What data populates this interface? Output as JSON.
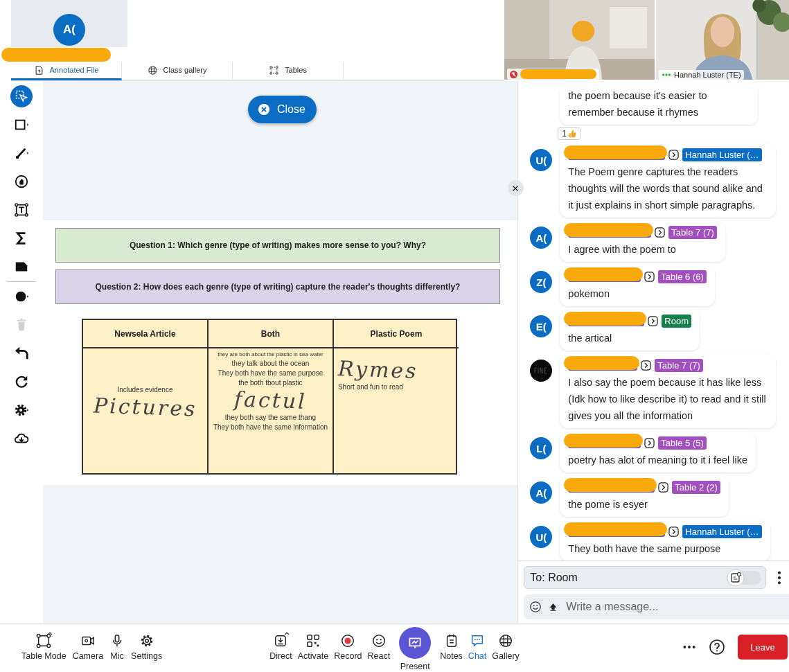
{
  "participant_tile": {
    "avatar": "A("
  },
  "tabs": [
    {
      "label": "Annotated File",
      "kind": "file",
      "selected": true
    },
    {
      "label": "Class gallery",
      "kind": "grid",
      "selected": false
    },
    {
      "label": "Tables",
      "kind": "tables",
      "selected": false
    }
  ],
  "videos": [
    {
      "kind": "picture",
      "muted": true
    },
    {
      "kind": "picture",
      "label": "Hannah Luster (TE)",
      "muted": false
    }
  ],
  "tools": [
    {
      "kind": "select",
      "selected": true,
      "disabled": false
    },
    {
      "kind": "shape",
      "selected": false,
      "disabled": false
    },
    {
      "kind": "brush",
      "selected": false,
      "disabled": false
    },
    {
      "kind": "stamp",
      "selected": false,
      "disabled": false
    },
    {
      "kind": "textbox",
      "selected": false,
      "disabled": false
    },
    {
      "kind": "math",
      "selected": false,
      "disabled": false
    },
    {
      "kind": "note",
      "selected": false,
      "disabled": false
    },
    {
      "kind": "color",
      "selected": false,
      "disabled": false
    },
    {
      "kind": "delete",
      "selected": false,
      "disabled": true
    },
    {
      "kind": "undo",
      "selected": false,
      "disabled": false
    },
    {
      "kind": "redo",
      "selected": false,
      "disabled": false
    },
    {
      "kind": "settings",
      "selected": false,
      "disabled": false
    },
    {
      "kind": "download",
      "selected": false,
      "disabled": false
    }
  ],
  "close_button": {
    "label": "Close"
  },
  "document": {
    "questions": [
      {
        "text": "Question 1:  Which genre (type of writing) makes more sense to you? Why?",
        "color": "#d9ead3"
      },
      {
        "text": "Question 2:  How does each genre (type of writing) capture the reader's thoughts differently?",
        "color": "#d9d2e9"
      }
    ],
    "columns": [
      "Newsela Article",
      "Both",
      "Plastic Poem"
    ],
    "cells": [
      [
        {
          "kind": "typed",
          "text": "Includes  evidence"
        },
        {
          "kind": "handwritten",
          "text": "Pictures"
        }
      ],
      [
        {
          "kind": "small",
          "text": "they are both about the plastic in sea water"
        },
        {
          "kind": "typed",
          "text": "they talk about the ocean"
        },
        {
          "kind": "typed",
          "text": "They both have the same purpose"
        },
        {
          "kind": "typed",
          "text": "the both tbout plastic"
        },
        {
          "kind": "handwritten",
          "text": "factul"
        },
        {
          "kind": "typed",
          "text": "they both say the same thang"
        },
        {
          "kind": "typed",
          "text": "They both have the same information"
        }
      ],
      [
        {
          "kind": "handwritten",
          "text": "Rymes"
        },
        {
          "kind": "typed",
          "text": "Short and fun to read"
        }
      ]
    ]
  },
  "chat": {
    "first_message": {
      "text": "the poem because it's easier to remember because it rhymes",
      "reaction_count": "1"
    },
    "messages": [
      {
        "avatar": "U(",
        "kind": "letters",
        "recipient": "Hannah Luster (…",
        "color": "#0b6cc4",
        "text": "The Poem genre captures the readers thoughts will the words that sound alike and it just explains in short simple paragraphs."
      },
      {
        "avatar": "A(",
        "kind": "letters",
        "recipient": "Table 7 (7)",
        "color": "#a24fc0",
        "text": "I agree with the poem to"
      },
      {
        "avatar": "Z(",
        "kind": "letters",
        "recipient": "Table 6 (6)",
        "color": "#a24fc0",
        "text": "pokemon"
      },
      {
        "avatar": "E(",
        "kind": "letters",
        "recipient": "Room",
        "color": "#16804c",
        "text": "the artical"
      },
      {
        "recipient": "Table 7 (7)",
        "color": "#a24fc0",
        "text": "I also say the poem because it has like less (Idk how to like describe it) to read and it still gives you all the information"
      },
      {
        "avatar": "L(",
        "kind": "letters",
        "recipient": "Table 5 (5)",
        "color": "#a24fc0",
        "text": "poetry has alot of meaning to it i feel like"
      },
      {
        "avatar": "A(",
        "kind": "letters",
        "recipient": "Table 2 (2)",
        "color": "#a24fc0",
        "text": "the pome is esyer"
      },
      {
        "avatar": "U(",
        "kind": "letters",
        "recipient": "Hannah Luster (…",
        "color": "#0b6cc4",
        "text": "They both have the same purpose"
      }
    ],
    "to": "To: Room",
    "toggle_on": false,
    "placeholder": "Write a message..."
  },
  "bottom_bar": {
    "left": [
      {
        "label": "Table Mode",
        "kind": "tablemode",
        "selected": false
      },
      {
        "label": "Camera",
        "kind": "camera",
        "selected": false
      },
      {
        "label": "Mic",
        "kind": "mic",
        "selected": false
      },
      {
        "label": "Settings",
        "kind": "settings",
        "selected": false
      }
    ],
    "center": [
      {
        "label": "Direct",
        "kind": "direct",
        "selected": false
      },
      {
        "label": "Activate",
        "kind": "activate",
        "selected": false
      },
      {
        "label": "Record",
        "kind": "record",
        "selected": false
      },
      {
        "label": "React",
        "kind": "react",
        "selected": false
      },
      {
        "label": "Present",
        "kind": "present",
        "selected": false
      },
      {
        "label": "Notes",
        "kind": "notes",
        "selected": false
      },
      {
        "label": "Chat",
        "kind": "chat",
        "selected": true
      },
      {
        "label": "Gallery",
        "kind": "gallery",
        "selected": false
      }
    ],
    "leave": "Leave"
  }
}
